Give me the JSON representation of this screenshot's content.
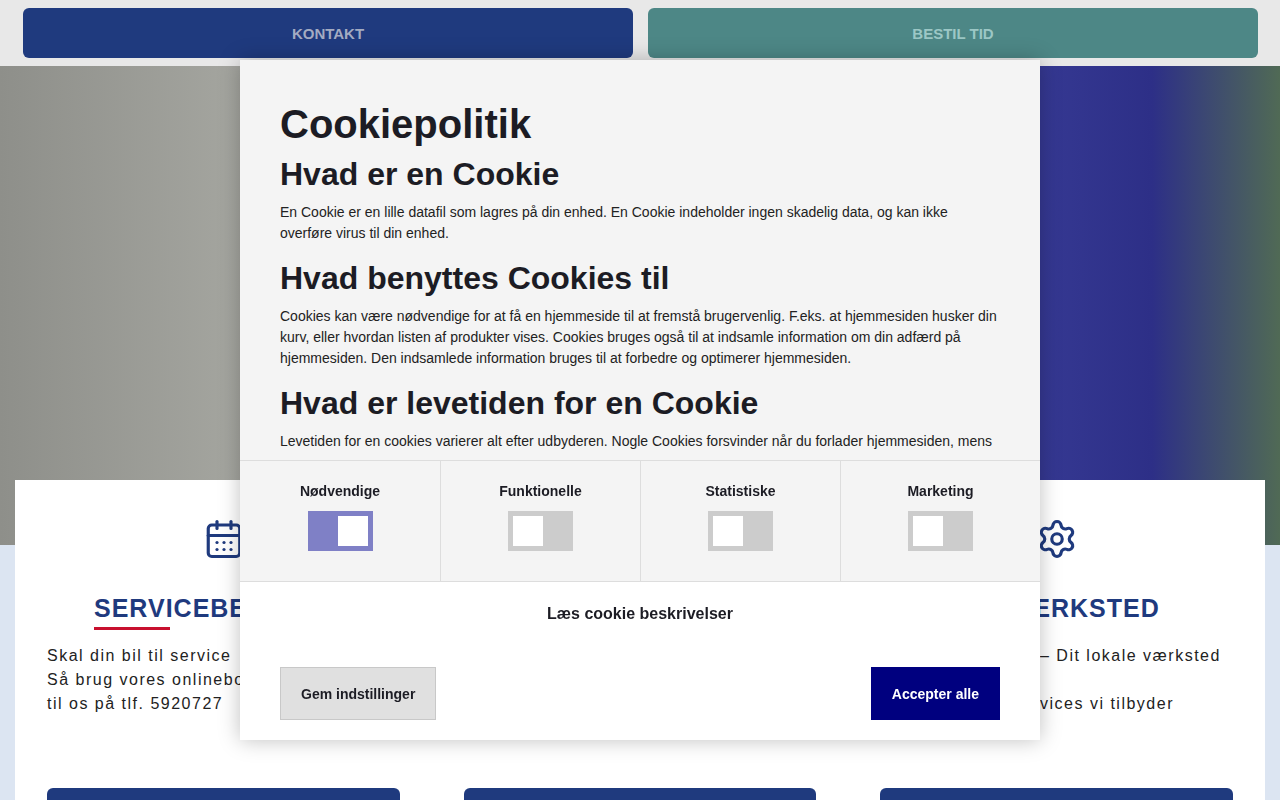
{
  "topbar": {
    "buttons": [
      {
        "label": "KONTAKT",
        "color": "#1f3a7e"
      },
      {
        "label": "BESTIL TID",
        "color": "#4d8786"
      }
    ]
  },
  "cards": [
    {
      "title": "SERVICEBES",
      "lines": [
        "Skal din bil til service",
        "Så brug vores onlinebo",
        "til os på tlf. 5920727"
      ]
    },
    {
      "title": "",
      "lines": []
    },
    {
      "title": "ÆRKSTED",
      "lines": [
        "– Dit lokale værksted",
        "",
        "vices vi tilbyder"
      ]
    }
  ],
  "modal": {
    "title": "Cookiepolitik",
    "sections": [
      {
        "heading": "Hvad er en Cookie",
        "text": "En Cookie er en lille datafil som lagres på din enhed. En Cookie indeholder ingen skadelig data, og kan ikke overføre virus til din enhed."
      },
      {
        "heading": "Hvad benyttes Cookies til",
        "text": "Cookies kan være nødvendige for at få en hjemmeside til at fremstå brugervenlig. F.eks. at hjemmesiden husker din kurv, eller hvordan listen af produkter vises. Cookies bruges også til at indsamle information om din adfærd på hjemmesiden. Den indsamlede information bruges til at forbedre og optimerer hjemmesiden."
      },
      {
        "heading": "Hvad er levetiden for en Cookie",
        "text": "Levetiden for en cookies varierer alt efter udbyderen. Nogle Cookies forsvinder når du forlader hjemmesiden, mens"
      }
    ],
    "toggles": [
      {
        "label": "Nødvendige",
        "on": true
      },
      {
        "label": "Funktionelle",
        "on": false
      },
      {
        "label": "Statistiske",
        "on": false
      },
      {
        "label": "Marketing",
        "on": false
      }
    ],
    "read_more": "Læs cookie beskrivelser",
    "buttons": {
      "save": "Gem indstillinger",
      "accept": "Accepter alle"
    }
  }
}
